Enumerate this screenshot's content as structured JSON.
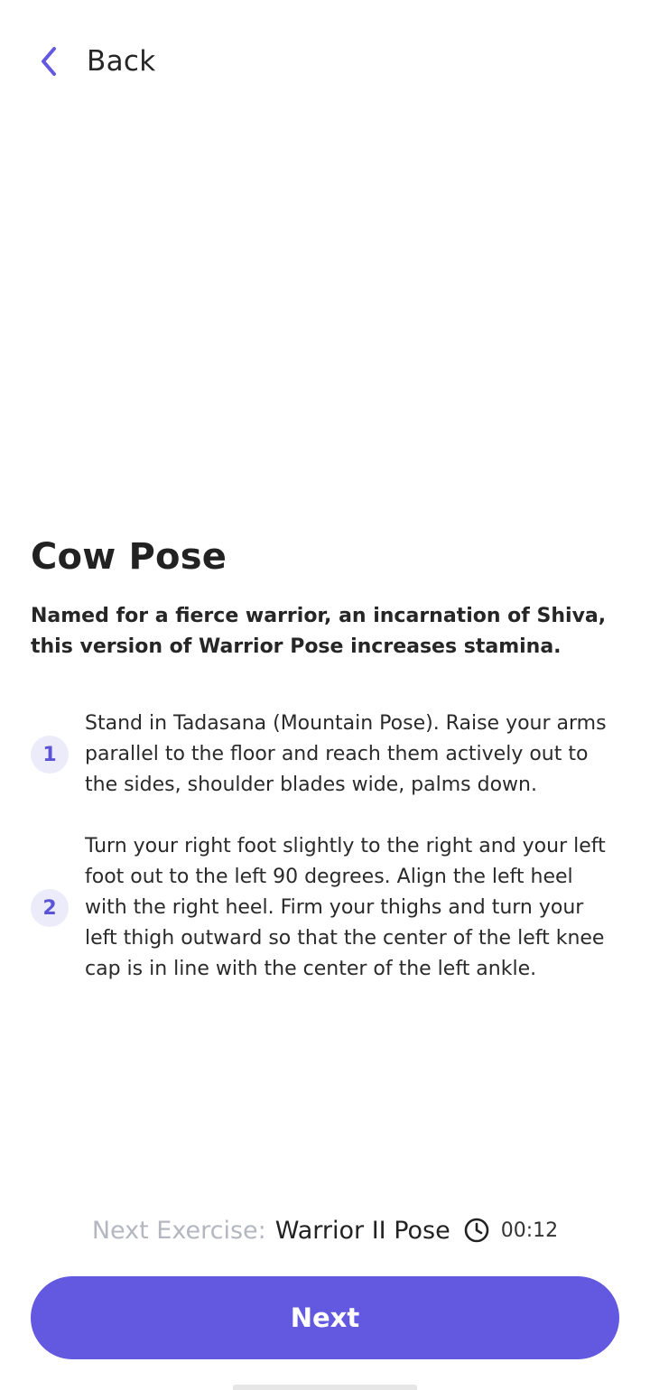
{
  "header": {
    "back_label": "Back"
  },
  "exercise": {
    "title": "Cow Pose",
    "description": "Named for a fierce warrior, an incarnation of Shiva, this version of Warrior Pose increases stamina.",
    "steps": [
      {
        "number": "1",
        "text": "Stand in Tadasana (Mountain Pose). Raise your arms parallel to the floor and reach them actively out to the sides, shoulder blades wide, palms down."
      },
      {
        "number": "2",
        "text": "Turn your right foot slightly to the right and your left foot out to the left 90 degrees. Align the left heel with the right heel. Firm your thighs and turn your left thigh outward so that the center of the left knee cap is in line with the center of the left ankle."
      }
    ]
  },
  "next_exercise": {
    "prefix": "Next Exercise:",
    "name": "Warrior II Pose",
    "time": "00:12",
    "icon": "clock-icon"
  },
  "footer": {
    "next_label": "Next"
  },
  "colors": {
    "accent": "#6259e0",
    "step_badge_bg": "#ecebfa",
    "muted_text": "#b4b7bf"
  },
  "icons": {
    "back": "chevron-left-icon",
    "timer": "clock-icon"
  }
}
